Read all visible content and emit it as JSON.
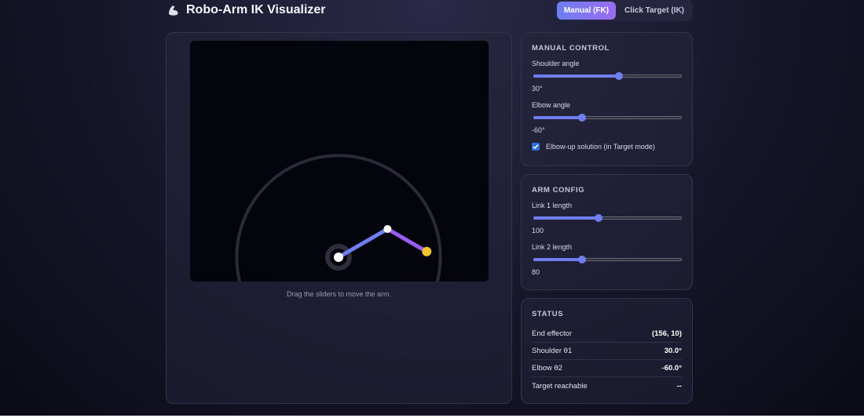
{
  "app": {
    "title": "Robo-Arm IK Visualizer",
    "icon": "flexed-biceps-icon"
  },
  "mode_toggle": {
    "manual_label": "Manual (FK)",
    "target_label": "Click Target (IK)",
    "active": "manual"
  },
  "canvas": {
    "hint": "Drag the sliders to move the arm.",
    "colors": {
      "link1": "#6f7ff2",
      "link2": "#9a5cf0",
      "end_effector": "#f2c230",
      "joint": "#ffffff",
      "reach_circle": "#2a2a38"
    }
  },
  "manual_control": {
    "title": "MANUAL CONTROL",
    "shoulder": {
      "label": "Shoulder angle",
      "value": 30,
      "min": -180,
      "max": 180,
      "display": "30°"
    },
    "elbow": {
      "label": "Elbow angle",
      "value": -60,
      "min": -180,
      "max": 180,
      "display": "-60°"
    },
    "elbow_up": {
      "label": "Elbow-up solution (in Target mode)",
      "checked": true
    }
  },
  "arm_config": {
    "title": "ARM CONFIG",
    "link1": {
      "label": "Link 1 length",
      "value": 100,
      "min": 20,
      "max": 200,
      "display": "100"
    },
    "link2": {
      "label": "Link 2 length",
      "value": 80,
      "min": 20,
      "max": 200,
      "display": "80"
    }
  },
  "status": {
    "title": "STATUS",
    "rows": [
      {
        "label": "End effector",
        "value": "(156, 10)"
      },
      {
        "label": "Shoulder θ1",
        "value": "30.0°"
      },
      {
        "label": "Elbow θ2",
        "value": "-60.0°"
      },
      {
        "label": "Target reachable",
        "value": "--"
      }
    ]
  }
}
